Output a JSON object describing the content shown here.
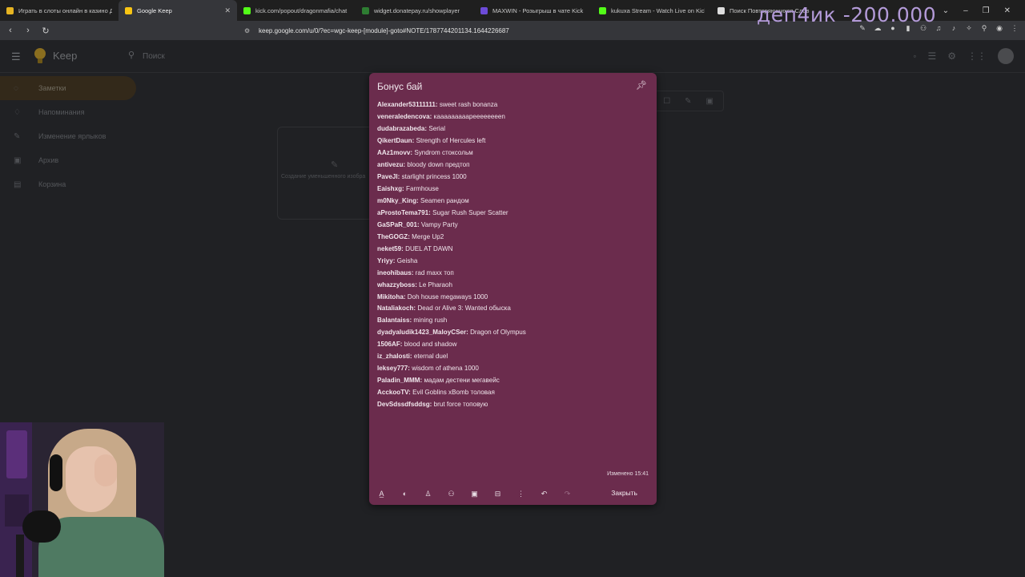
{
  "browser": {
    "tabs": [
      {
        "title": "Играть в слоты онлайн в казино Др",
        "favicon_color": "#e6b422",
        "active": false
      },
      {
        "title": "Google Keep",
        "favicon_color": "#f9c513",
        "active": true,
        "close": "✕"
      },
      {
        "title": "kick.com/popout/dragonmafia/chat",
        "favicon_color": "#53fc18",
        "active": false
      },
      {
        "title": "widget.donatepay.ru/showplayer",
        "favicon_color": "#2e7d32",
        "favicon_letter": "D",
        "active": false
      },
      {
        "title": "MAXWIN - Розыгрыш в чате Kick",
        "favicon_color": "#6c4bd8",
        "active": false
      },
      {
        "title": "kukuxa Stream - Watch Live on Kick",
        "favicon_color": "#53fc18",
        "active": false
      },
      {
        "title": "Поиск Повторяющихся Слов",
        "favicon_color": "#dddddd",
        "active": false
      }
    ],
    "window_controls": [
      "⌄",
      "–",
      "❐",
      "✕"
    ],
    "url": "keep.google.com/u/0/?ec=wgc-keep-[module]-goto#NOTE/1787744201134.1644226687",
    "nav": {
      "back": "‹",
      "forward": "›",
      "reload": "↻"
    }
  },
  "overlay": {
    "counter_text": "деп4ик -200.000",
    "superscript": "+"
  },
  "keep": {
    "app_name": "Keep",
    "search_placeholder": "Поиск",
    "sidebar": [
      {
        "label": "Заметки",
        "icon": "bulb-icon",
        "active": true
      },
      {
        "label": "Напоминания",
        "icon": "bell-icon",
        "active": false
      },
      {
        "label": "Изменение ярлыков",
        "icon": "pencil-icon",
        "active": false
      },
      {
        "label": "Архив",
        "icon": "archive-icon",
        "active": false
      },
      {
        "label": "Корзина",
        "icon": "trash-icon",
        "active": false
      }
    ],
    "bg_card_caption": "Создание уменьшенного изобра"
  },
  "note": {
    "title": "Бонус бай",
    "lines": [
      {
        "user": "Alexander53111111:",
        "text": " sweet rash bonanza"
      },
      {
        "user": "veneraledencova:",
        "text": " кааааааааарееееееееn"
      },
      {
        "user": "dudabrazabeda:",
        "text": " Serial"
      },
      {
        "user": "QikertDaun:",
        "text": " Strength of Hercules left"
      },
      {
        "user": "AAz1movv:",
        "text": " Syndrom стоксольм"
      },
      {
        "user": "antivezu:",
        "text": " bloody down предтоп"
      },
      {
        "user": "PaveJl:",
        "text": " starlight princess 1000"
      },
      {
        "user": "Eaishxg:",
        "text": " Farmhouse"
      },
      {
        "user": "m0Nky_King:",
        "text": " Seamen рандом"
      },
      {
        "user": "aProstoTema791:",
        "text": " Sugar Rush Super Scatter"
      },
      {
        "user": "GaSPaR_001:",
        "text": " Vampy Party"
      },
      {
        "user": "TheGOGZ:",
        "text": " Merge Up2"
      },
      {
        "user": "neket59:",
        "text": " DUEL AT DAWN"
      },
      {
        "user": "Yriyy:",
        "text": " Geisha"
      },
      {
        "user": "ineohibaus:",
        "text": " rad maxx топ"
      },
      {
        "user": "whazzyboss:",
        "text": " Le Pharaoh"
      },
      {
        "user": "Mikitoha:",
        "text": " Doh house megaways 1000"
      },
      {
        "user": "Nataliakoch:",
        "text": " Dead or Alive 3: Wanted обыска"
      },
      {
        "user": "Balantaiss:",
        "text": " mining rush"
      },
      {
        "user": "dyadyaludik1423_MaloyCSer:",
        "text": " Dragon of Olympus"
      },
      {
        "user": "1506AF:",
        "text": " blood and shadow"
      },
      {
        "user": "iz_zhalosti:",
        "text": " eternal duel"
      },
      {
        "user": "leksey777:",
        "text": " wisdom of athena 1000"
      },
      {
        "user": "Paladin_MMM:",
        "text": " мадам дестени мегавейс"
      },
      {
        "user": "AcckooTV:",
        "text": " Evil Goblins xBomb толовая"
      },
      {
        "user": "DevSdssdfsddsg:",
        "text": " brut force топовую"
      }
    ],
    "edited": "Изменено 15:41",
    "close_label": "Закрыть",
    "toolbar_icons": [
      "text-format-icon",
      "palette-icon",
      "bell-icon",
      "add-collaborator-icon",
      "image-icon",
      "archive-icon",
      "more-icon",
      "undo-icon",
      "redo-icon"
    ]
  }
}
